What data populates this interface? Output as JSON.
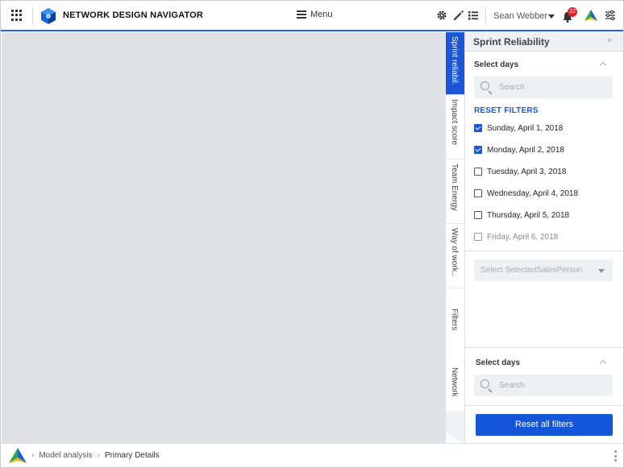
{
  "header": {
    "app_title": "NETWORK DESIGN NAVIGATOR",
    "menu_label": "Menu",
    "user_name": "Sean Webber",
    "notification_count": "22",
    "icons": [
      "apps-grid-icon",
      "app-logo-icon",
      "gear-icon",
      "pencil-icon",
      "list-icon",
      "bell-icon",
      "brand-logo-icon",
      "sliders-icon"
    ],
    "accent_color": "#1a56d6"
  },
  "vertical_tabs": [
    {
      "label": "Sprint reliabil.",
      "active": true
    },
    {
      "label": "Impact score",
      "active": false
    },
    {
      "label": "Team Energy",
      "active": false
    },
    {
      "label": "Way of work..",
      "active": false
    },
    {
      "label": "Filters",
      "active": false
    },
    {
      "label": "Network",
      "active": false
    }
  ],
  "panel": {
    "title": "Sprint Reliability",
    "collapse_glyph": "»",
    "section1": {
      "title": "Select days",
      "search_placeholder": "Search",
      "reset_filters_label": "RESET FILTERS",
      "days": [
        {
          "label": "Sunday, April 1, 2018",
          "checked": true
        },
        {
          "label": "Monday, April 2, 2018",
          "checked": true
        },
        {
          "label": "Tuesday, April 3, 2018",
          "checked": false
        },
        {
          "label": "Wednesday, April 4, 2018",
          "checked": false
        },
        {
          "label": "Thursday, April 5, 2018",
          "checked": false
        },
        {
          "label": "Friday, April 6, 2018",
          "checked": false
        }
      ]
    },
    "select_placeholder": "Select SelectedSalesPerson",
    "section2": {
      "title": "Select days",
      "search_placeholder": "Search"
    },
    "reset_all_label": "Reset all filters"
  },
  "footer": {
    "breadcrumbs": [
      "Model analysis",
      "Primary Details"
    ],
    "separator": "›"
  }
}
